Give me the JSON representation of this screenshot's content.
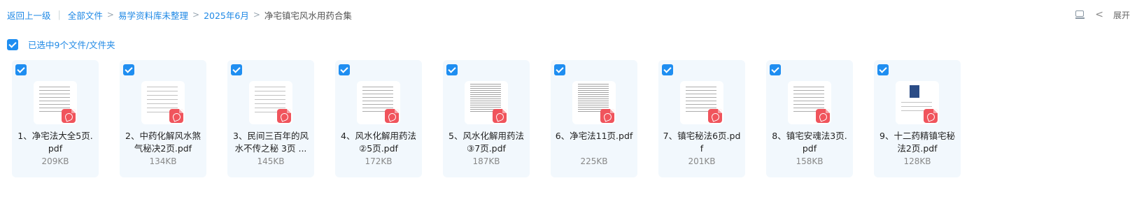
{
  "breadcrumb": {
    "back": "返回上一级",
    "items": [
      "全部文件",
      "易学资料库未整理",
      "2025年6月"
    ],
    "current": "净宅镇宅风水用药合集",
    "separator": "|",
    "chevron": ">"
  },
  "toolbar": {
    "view_icon": "list-view-icon",
    "expand_chevron": "<",
    "expand_label": "展开"
  },
  "selection": {
    "label": "已选中9个文件/文件夹"
  },
  "files": [
    {
      "name": "1、净宅法大全5页.pdf",
      "size": "209KB"
    },
    {
      "name": "2、中药化解风水煞气秘决2页.pdf",
      "size": "134KB"
    },
    {
      "name": "3、民间三百年的风水不传之秘 3页 ...",
      "size": "145KB"
    },
    {
      "name": "4、风水化解用药法②5页.pdf",
      "size": "172KB"
    },
    {
      "name": "5、风水化解用药法③7页.pdf",
      "size": "187KB"
    },
    {
      "name": "6、净宅法11页.pdf",
      "size": "225KB"
    },
    {
      "name": "7、镇宅秘法6页.pdf",
      "size": "201KB"
    },
    {
      "name": "8、镇宅安魂法3页.pdf",
      "size": "158KB"
    },
    {
      "name": "9、十二药精镇宅秘法2页.pdf",
      "size": "128KB"
    }
  ],
  "colors": {
    "accent": "#1e88e5",
    "card_bg": "#f2f8fd",
    "checkbox": "#1f8ef1",
    "pdf_badge": "#f0545c"
  }
}
